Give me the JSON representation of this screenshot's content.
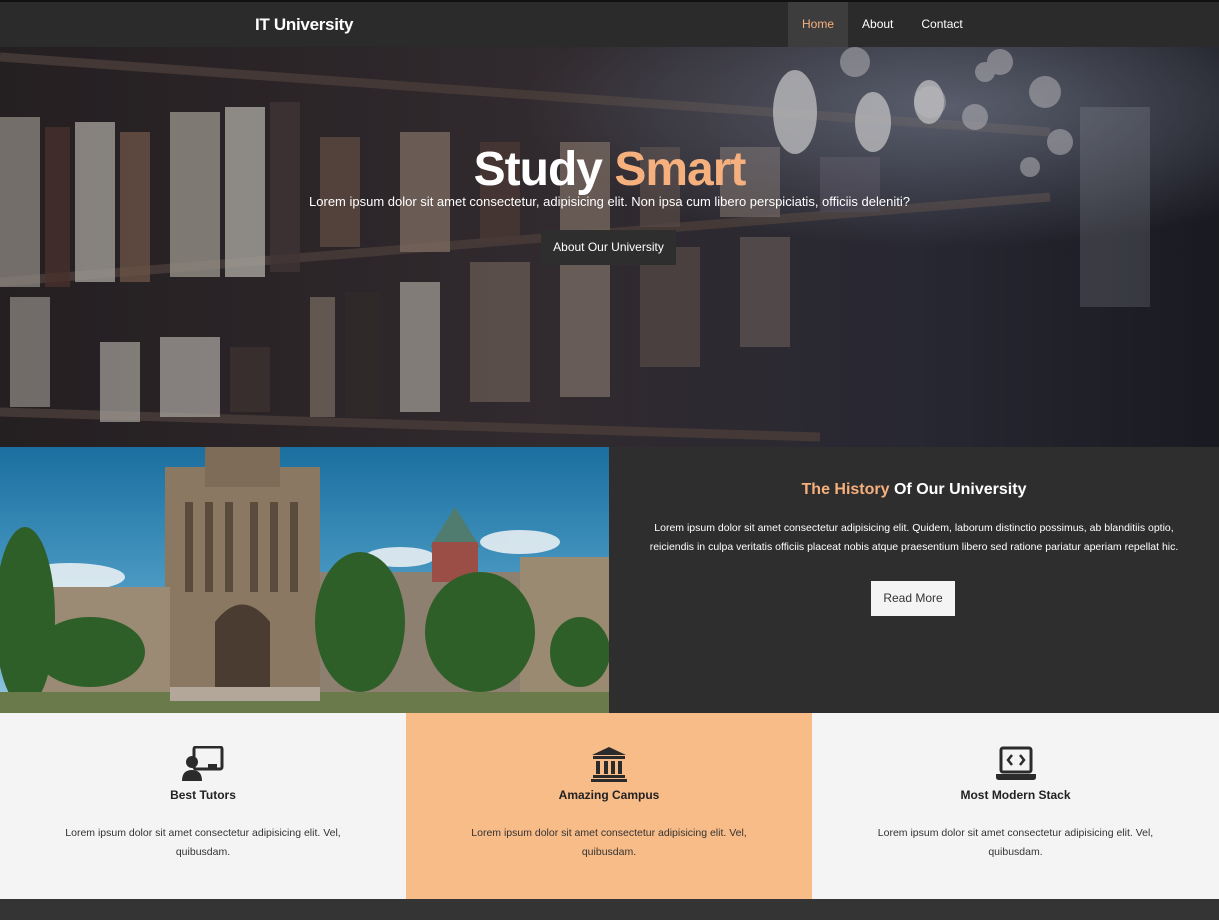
{
  "navbar": {
    "brand": "IT University",
    "links": [
      {
        "label": "Home",
        "active": true
      },
      {
        "label": "About",
        "active": false
      },
      {
        "label": "Contact",
        "active": false
      }
    ]
  },
  "hero": {
    "title_main": "Study",
    "title_accent": "Smart",
    "subtitle": "Lorem ipsum dolor sit amet consectetur, adipisicing elit. Non ipsa cum libero perspiciatis, officiis deleniti?",
    "button_label": "About Our University"
  },
  "history": {
    "title_accent": "The History",
    "title_rest": "Of Our University",
    "text": "Lorem ipsum dolor sit amet consectetur adipisicing elit. Quidem, laborum distinctio possimus, ab blanditiis optio, reiciendis in culpa veritatis officiis placeat nobis atque praesentium libero sed ratione pariatur aperiam repellat hic.",
    "button_label": "Read More"
  },
  "features": [
    {
      "icon": "teacher-icon",
      "title": "Best Tutors",
      "text": "Lorem ipsum dolor sit amet consectetur adipisicing elit. Vel, quibusdam."
    },
    {
      "icon": "university-icon",
      "title": "Amazing Campus",
      "text": "Lorem ipsum dolor sit amet consectetur adipisicing elit. Vel, quibusdam."
    },
    {
      "icon": "laptop-code-icon",
      "title": "Most Modern Stack",
      "text": "Lorem ipsum dolor sit amet consectetur adipisicing elit. Vel, quibusdam."
    }
  ],
  "colors": {
    "accent": "#f6b07e",
    "dark": "#2e2e2e",
    "light": "#f4f4f4",
    "feature_highlight": "#f8bc89"
  }
}
